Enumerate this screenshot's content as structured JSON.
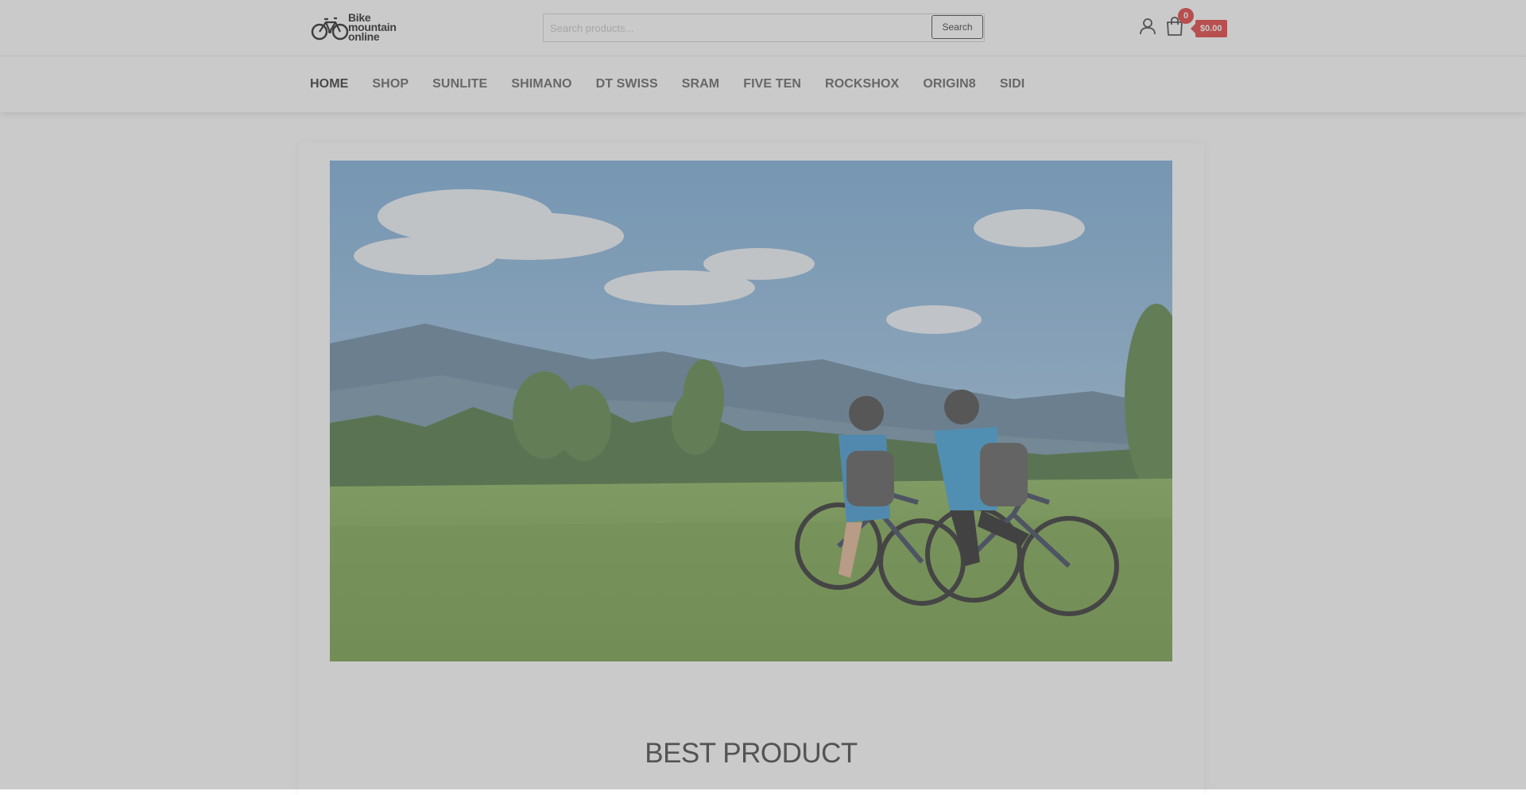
{
  "header": {
    "logo_line1": "Bike",
    "logo_line2": "mountain",
    "logo_line3": "online",
    "search_placeholder": "Search products...",
    "search_button": "Search",
    "cart_count": "0",
    "cart_total": "$0.00"
  },
  "nav": {
    "items": [
      "HOME",
      "SHOP",
      "SUNLITE",
      "SHIMANO",
      "DT SWISS",
      "SRAM",
      "FIVE TEN",
      "ROCKSHOX",
      "ORIGIN8",
      "SIDI"
    ]
  },
  "main": {
    "section_title": "BEST PRODUCT"
  },
  "colors": {
    "accent": "#e02b2b",
    "overlay": "#808080"
  },
  "icons": [
    "bike-logo-icon",
    "user-icon",
    "cart-icon"
  ]
}
